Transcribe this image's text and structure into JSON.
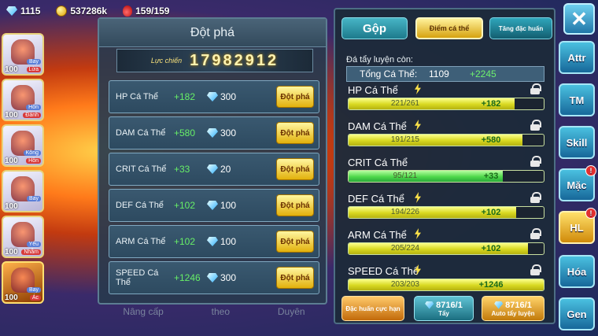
{
  "resources": [
    {
      "icon": "gem-icon",
      "value": "1115"
    },
    {
      "icon": "gold-coin-icon",
      "value": "537286k"
    },
    {
      "icon": "potion-icon",
      "value": "159/159"
    }
  ],
  "pets": [
    {
      "level": "100",
      "tag1": "Bay",
      "tag2": "Lửa"
    },
    {
      "level": "100",
      "tag1": "Hồn",
      "tag2": "Đánh"
    },
    {
      "level": "100",
      "tag1": "Kông",
      "tag2": "Hồn"
    },
    {
      "level": "100",
      "tag1": "Bay",
      "tag2": ""
    },
    {
      "level": "100",
      "tag1": "Yêu",
      "tag2": "Nhẫm"
    },
    {
      "level": "100",
      "tag1": "Bay",
      "tag2": "Ác"
    }
  ],
  "breakthrough": {
    "title": "Đột phá",
    "power_label": "Lực chiến",
    "power_value": "17982912",
    "rows": [
      {
        "name": "HP Cá Thể",
        "bonus": "+182",
        "cost": "300",
        "button": "Đột phá"
      },
      {
        "name": "DAM Cá Thể",
        "bonus": "+580",
        "cost": "300",
        "button": "Đột phá"
      },
      {
        "name": "CRIT Cá Thể",
        "bonus": "+33",
        "cost": "20",
        "button": "Đột phá"
      },
      {
        "name": "DEF Cá Thể",
        "bonus": "+102",
        "cost": "100",
        "button": "Đột phá"
      },
      {
        "name": "ARM Cá Thể",
        "bonus": "+102",
        "cost": "100",
        "button": "Đột phá"
      },
      {
        "name": "SPEED Cá Thể",
        "bonus": "+1246",
        "cost": "300",
        "button": "Đột phá"
      }
    ],
    "bottom_labels": [
      "Nâng cấp",
      "theo",
      "Duyên"
    ]
  },
  "training": {
    "tabs": [
      "Gộp",
      "Điểm cá thể",
      "Tăng đặc huấn"
    ],
    "remaining_label": "Đá tẩy luyện còn:",
    "total_label": "Tổng Cá Thể:",
    "total_value": "1109",
    "total_bonus": "+2245",
    "stats": [
      {
        "name": "HP Cá Thể",
        "current": "221/261",
        "bonus": "+182",
        "ratio": 0.85,
        "boost": true,
        "green": false
      },
      {
        "name": "DAM Cá Thể",
        "current": "191/215",
        "bonus": "+580",
        "ratio": 0.89,
        "boost": true,
        "green": false
      },
      {
        "name": "CRIT Cá Thể",
        "current": "95/121",
        "bonus": "+33",
        "ratio": 0.79,
        "boost": false,
        "green": true
      },
      {
        "name": "DEF Cá Thể",
        "current": "194/226",
        "bonus": "+102",
        "ratio": 0.86,
        "boost": true,
        "green": false
      },
      {
        "name": "ARM Cá Thể",
        "current": "205/224",
        "bonus": "+102",
        "ratio": 0.92,
        "boost": true,
        "green": false
      },
      {
        "name": "SPEED Cá Thể",
        "current": "203/203",
        "bonus": "+1246",
        "ratio": 1.0,
        "boost": true,
        "green": false
      }
    ],
    "actions": [
      {
        "label": "Đặc huấn cực hạn",
        "count": ""
      },
      {
        "label": "Tẩy",
        "count": "8716/1"
      },
      {
        "label": "Auto tẩy luyện",
        "count": "8716/1"
      }
    ]
  },
  "nav": {
    "close_label": "✕",
    "items": [
      {
        "label": "Attr",
        "badge": false
      },
      {
        "label": "TM",
        "badge": false
      },
      {
        "label": "Skill",
        "badge": false
      },
      {
        "label": "Mặc",
        "badge": true
      },
      {
        "label": "HL",
        "badge": true
      },
      {
        "label": "Hóa",
        "badge": false
      },
      {
        "label": "Gen",
        "badge": false
      }
    ],
    "badge_text": "!"
  },
  "colors": {
    "accent": "#e2b10c",
    "bonus": "#6ef06e",
    "panel": "#283a4e"
  }
}
